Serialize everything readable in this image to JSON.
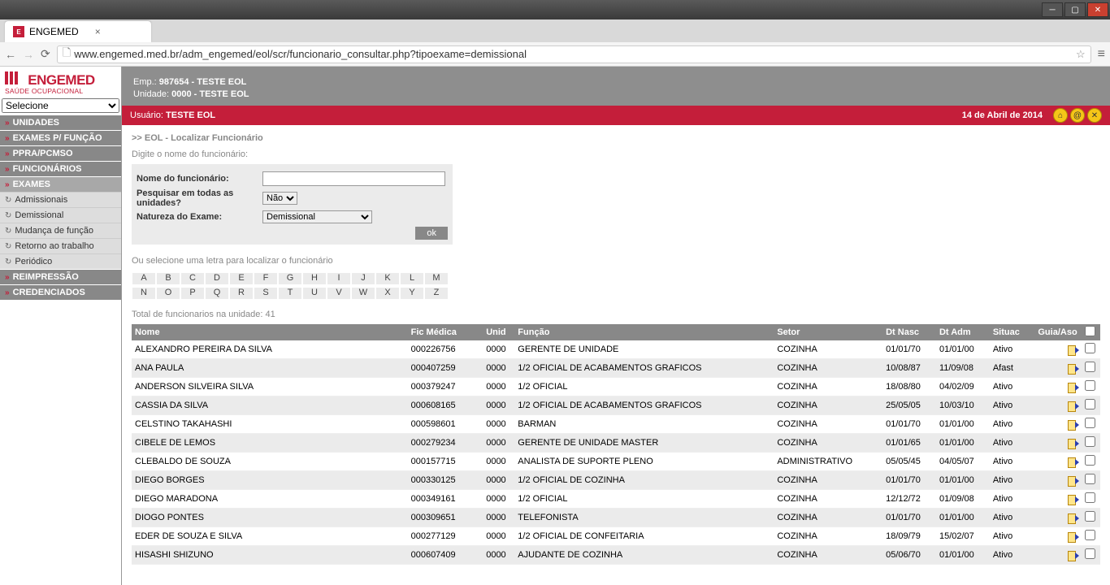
{
  "window": {
    "title": "ENGEMED"
  },
  "url": "www.engemed.med.br/adm_engemed/eol/scr/funcionario_consultar.php?tipoexame=demissional",
  "logo": {
    "brand": "ENGEMED",
    "tagline": "SAÚDE OCUPACIONAL"
  },
  "selector": {
    "value": "Selecione"
  },
  "nav": {
    "items": [
      {
        "label": "UNIDADES",
        "type": "hdr"
      },
      {
        "label": "EXAMES P/ FUNÇÃO",
        "type": "hdr"
      },
      {
        "label": "PPRA/PCMSO",
        "type": "hdr"
      },
      {
        "label": "FUNCIONÁRIOS",
        "type": "hdr"
      },
      {
        "label": "EXAMES",
        "type": "hdr",
        "active": true
      },
      {
        "label": "Admissionais",
        "type": "sub"
      },
      {
        "label": "Demissional",
        "type": "sub"
      },
      {
        "label": "Mudança de função",
        "type": "sub"
      },
      {
        "label": "Retorno ao trabalho",
        "type": "sub"
      },
      {
        "label": "Periódico",
        "type": "sub"
      },
      {
        "label": "REIMPRESSÃO",
        "type": "hdr"
      },
      {
        "label": "CREDENCIADOS",
        "type": "hdr"
      }
    ]
  },
  "top": {
    "emp_label": "Emp.:",
    "emp_value": "987654 - TESTE EOL",
    "unid_label": "Unidade:",
    "unid_value": "0000 - TESTE EOL"
  },
  "redbar": {
    "user_label": "Usuário:",
    "user_name": "TESTE EOL",
    "date": "14 de Abril de 2014"
  },
  "page": {
    "crumb": ">> EOL - Localizar Funcionário",
    "prompt": "Digite o nome do funcionário:",
    "form": {
      "name_label": "Nome do funcionário:",
      "all_units_label": "Pesquisar em todas as unidades?",
      "all_units_value": "Não",
      "nature_label": "Natureza do Exame:",
      "nature_value": "Demissional",
      "ok": "ok"
    },
    "letter_prompt": "Ou selecione uma letra para localizar o funcionário",
    "alpha1": [
      "A",
      "B",
      "C",
      "D",
      "E",
      "F",
      "G",
      "H",
      "I",
      "J",
      "K",
      "L",
      "M"
    ],
    "alpha2": [
      "N",
      "O",
      "P",
      "Q",
      "R",
      "S",
      "T",
      "U",
      "V",
      "W",
      "X",
      "Y",
      "Z"
    ],
    "total_label": "Total de funcionarios na unidade: 41",
    "columns": {
      "nome": "Nome",
      "fic": "Fic Médica",
      "unid": "Unid",
      "func": "Função",
      "setor": "Setor",
      "nasc": "Dt Nasc",
      "adm": "Dt Adm",
      "sit": "Situac",
      "guia": "Guia/Aso"
    },
    "rows": [
      {
        "nome": "ALEXANDRO PEREIRA DA SILVA",
        "fic": "000226756",
        "unid": "0000",
        "func": "GERENTE DE UNIDADE",
        "setor": "COZINHA",
        "nasc": "01/01/70",
        "adm": "01/01/00",
        "sit": "Ativo"
      },
      {
        "nome": "ANA PAULA",
        "fic": "000407259",
        "unid": "0000",
        "func": "1/2 OFICIAL DE ACABAMENTOS GRAFICOS",
        "setor": "COZINHA",
        "nasc": "10/08/87",
        "adm": "11/09/08",
        "sit": "Afast"
      },
      {
        "nome": "ANDERSON SILVEIRA SILVA",
        "fic": "000379247",
        "unid": "0000",
        "func": "1/2 OFICIAL",
        "setor": "COZINHA",
        "nasc": "18/08/80",
        "adm": "04/02/09",
        "sit": "Ativo"
      },
      {
        "nome": "CASSIA DA SILVA",
        "fic": "000608165",
        "unid": "0000",
        "func": "1/2 OFICIAL DE ACABAMENTOS GRAFICOS",
        "setor": "COZINHA",
        "nasc": "25/05/05",
        "adm": "10/03/10",
        "sit": "Ativo"
      },
      {
        "nome": "CELSTINO TAKAHASHI",
        "fic": "000598601",
        "unid": "0000",
        "func": "BARMAN",
        "setor": "COZINHA",
        "nasc": "01/01/70",
        "adm": "01/01/00",
        "sit": "Ativo"
      },
      {
        "nome": "CIBELE DE LEMOS",
        "fic": "000279234",
        "unid": "0000",
        "func": "GERENTE DE UNIDADE MASTER",
        "setor": "COZINHA",
        "nasc": "01/01/65",
        "adm": "01/01/00",
        "sit": "Ativo"
      },
      {
        "nome": "CLEBALDO DE SOUZA",
        "fic": "000157715",
        "unid": "0000",
        "func": "ANALISTA DE SUPORTE PLENO",
        "setor": "ADMINISTRATIVO",
        "nasc": "05/05/45",
        "adm": "04/05/07",
        "sit": "Ativo"
      },
      {
        "nome": "DIEGO BORGES",
        "fic": "000330125",
        "unid": "0000",
        "func": "1/2 OFICIAL DE COZINHA",
        "setor": "COZINHA",
        "nasc": "01/01/70",
        "adm": "01/01/00",
        "sit": "Ativo"
      },
      {
        "nome": "DIEGO MARADONA",
        "fic": "000349161",
        "unid": "0000",
        "func": "1/2 OFICIAL",
        "setor": "COZINHA",
        "nasc": "12/12/72",
        "adm": "01/09/08",
        "sit": "Ativo"
      },
      {
        "nome": "DIOGO PONTES",
        "fic": "000309651",
        "unid": "0000",
        "func": "TELEFONISTA",
        "setor": "COZINHA",
        "nasc": "01/01/70",
        "adm": "01/01/00",
        "sit": "Ativo"
      },
      {
        "nome": "EDER DE SOUZA E SILVA",
        "fic": "000277129",
        "unid": "0000",
        "func": "1/2 OFICIAL DE CONFEITARIA",
        "setor": "COZINHA",
        "nasc": "18/09/79",
        "adm": "15/02/07",
        "sit": "Ativo"
      },
      {
        "nome": "HISASHI SHIZUNO",
        "fic": "000607409",
        "unid": "0000",
        "func": "AJUDANTE DE COZINHA",
        "setor": "COZINHA",
        "nasc": "05/06/70",
        "adm": "01/01/00",
        "sit": "Ativo"
      }
    ]
  }
}
